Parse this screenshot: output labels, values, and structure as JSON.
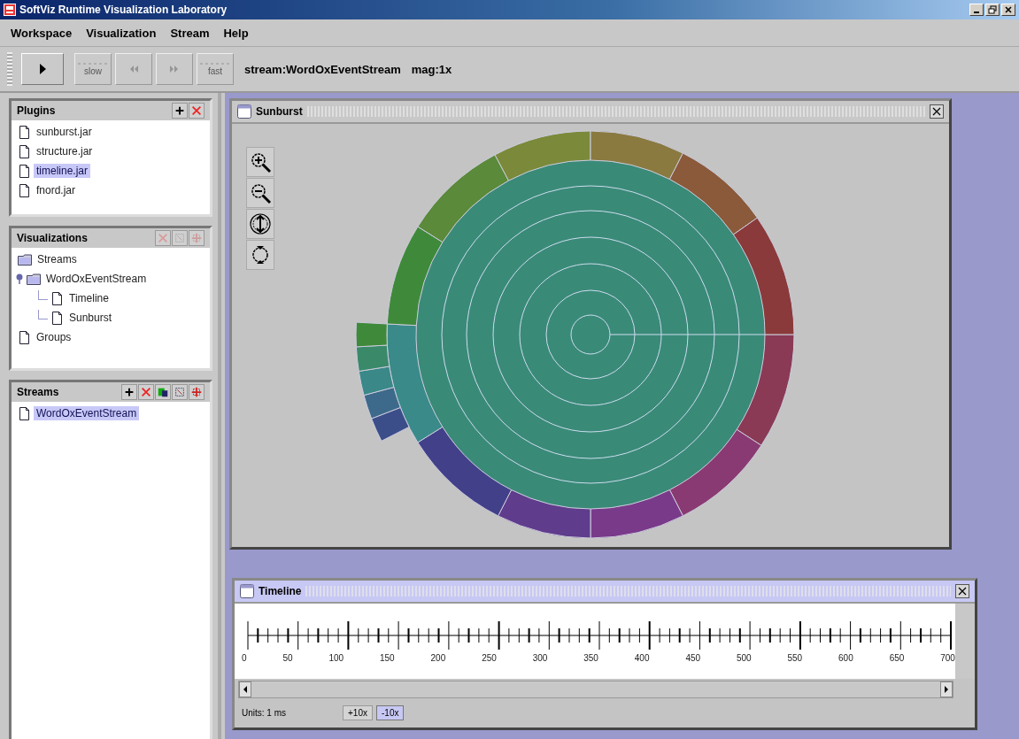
{
  "window": {
    "title": "SoftViz Runtime Visualization Laboratory"
  },
  "menu": [
    {
      "label": "Workspace"
    },
    {
      "label": "Visualization"
    },
    {
      "label": "Stream"
    },
    {
      "label": "Help"
    }
  ],
  "toolbar": {
    "buttons": [
      {
        "kind": "play",
        "disabled": false
      },
      {
        "kind": "slow",
        "label": "slow",
        "disabled": true
      },
      {
        "kind": "rewind",
        "disabled": true
      },
      {
        "kind": "forward",
        "disabled": true
      },
      {
        "kind": "fast",
        "label": "fast",
        "disabled": true
      }
    ],
    "stream": "stream:WordOxEventStream",
    "magnification": "mag:1x"
  },
  "panels": [
    {
      "title": "Plugins",
      "actions": [
        {
          "kind": "add",
          "disabled": false
        },
        {
          "kind": "remove",
          "disabled": false
        }
      ],
      "items": [
        {
          "label": "sunburst.jar",
          "kind": "file",
          "selected": false
        },
        {
          "label": "structure.jar",
          "kind": "file",
          "selected": false
        },
        {
          "label": "timeline.jar",
          "kind": "file",
          "selected": true
        },
        {
          "label": "fnord.jar",
          "kind": "file",
          "selected": false
        }
      ]
    },
    {
      "title": "Visualizations",
      "actions": [
        {
          "kind": "remove",
          "disabled": true
        },
        {
          "kind": "edit",
          "disabled": true
        },
        {
          "kind": "split",
          "disabled": true
        }
      ],
      "items": [
        {
          "label": "Streams",
          "kind": "folder",
          "selected": false
        },
        {
          "label": "WordOxEventStream",
          "kind": "folder",
          "selected": false,
          "children": [
            {
              "label": "Timeline",
              "kind": "file",
              "selected": false
            },
            {
              "label": "Sunburst",
              "kind": "file",
              "selected": false
            }
          ]
        },
        {
          "label": "Groups",
          "kind": "file",
          "selected": false
        }
      ]
    },
    {
      "title": "Streams",
      "actions": [
        {
          "kind": "add",
          "disabled": false
        },
        {
          "kind": "remove",
          "disabled": false
        },
        {
          "kind": "open",
          "disabled": false
        },
        {
          "kind": "edit",
          "disabled": false
        },
        {
          "kind": "split",
          "disabled": false
        }
      ],
      "items": [
        {
          "label": "WordOxEventStream",
          "kind": "file",
          "selected": true
        }
      ]
    }
  ],
  "frames": [
    {
      "kind": "sunburst",
      "title": "Sunburst",
      "active": false,
      "tools": [
        {
          "kind": "zoom-in"
        },
        {
          "kind": "zoom-out"
        },
        {
          "kind": "pan"
        },
        {
          "kind": "rotate"
        }
      ]
    },
    {
      "kind": "timeline",
      "title": "Timeline",
      "active": true,
      "ruler_labels": [
        "0",
        "50",
        "100",
        "150",
        "200",
        "250",
        "300",
        "350",
        "400",
        "450",
        "500",
        "550",
        "600",
        "650",
        "700"
      ],
      "units": "Units: 1 ms",
      "buttons": [
        {
          "label": "+10x",
          "selected": false
        },
        {
          "label": "-10x",
          "selected": true
        }
      ]
    }
  ]
}
